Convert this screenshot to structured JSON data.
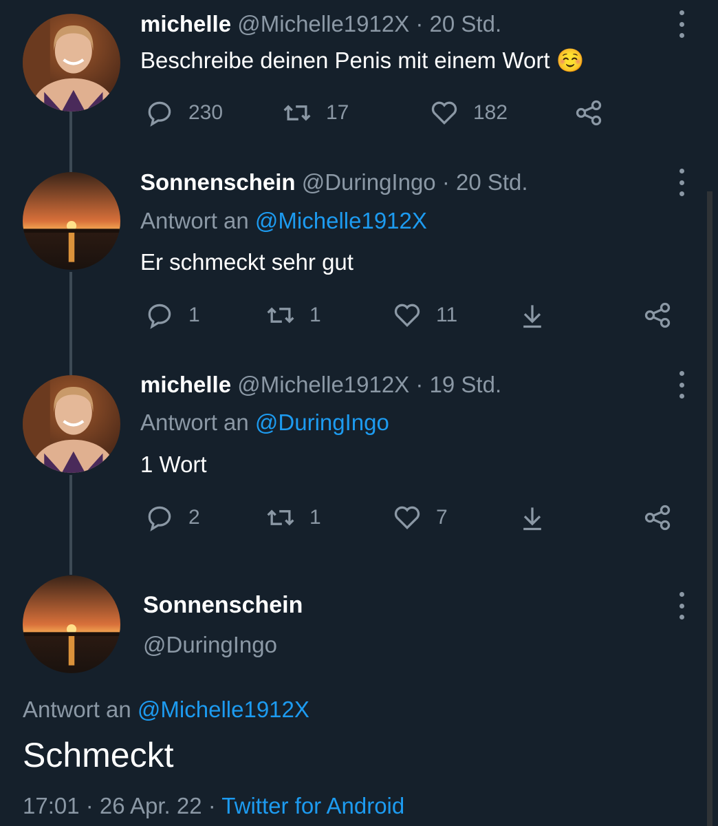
{
  "tweets": [
    {
      "name": "michelle",
      "handle": "@Michelle1912X",
      "time": "· 20 Std.",
      "text": "Beschreibe deinen Penis mit einem Wort",
      "emoji": "☺️",
      "replies": "230",
      "retweets": "17",
      "likes": "182"
    },
    {
      "name": "Sonnenschein",
      "handle": "@DuringIngo",
      "time": "· 20 Std.",
      "reply_prefix": "Antwort an",
      "reply_to": "@Michelle1912X",
      "text": "Er schmeckt sehr gut",
      "replies": "1",
      "retweets": "1",
      "likes": "11"
    },
    {
      "name": "michelle",
      "handle": "@Michelle1912X",
      "time": "· 19 Std.",
      "reply_prefix": "Antwort an",
      "reply_to": "@DuringIngo",
      "text": "1 Wort",
      "replies": "2",
      "retweets": "1",
      "likes": "7"
    }
  ],
  "focused": {
    "name": "Sonnenschein",
    "handle": "@DuringIngo",
    "reply_prefix": "Antwort an",
    "reply_to": "@Michelle1912X",
    "text": "Schmeckt",
    "time": "17:01",
    "date": "· 26 Apr. 22 ·",
    "source": "Twitter for Android"
  },
  "colors": {
    "background": "#15202b",
    "muted": "#8b98a5",
    "link": "#1d9bf0",
    "thread_line": "#3d4a55"
  },
  "icons": [
    "reply-icon",
    "retweet-icon",
    "like-icon",
    "download-icon",
    "share-icon",
    "more-icon"
  ]
}
